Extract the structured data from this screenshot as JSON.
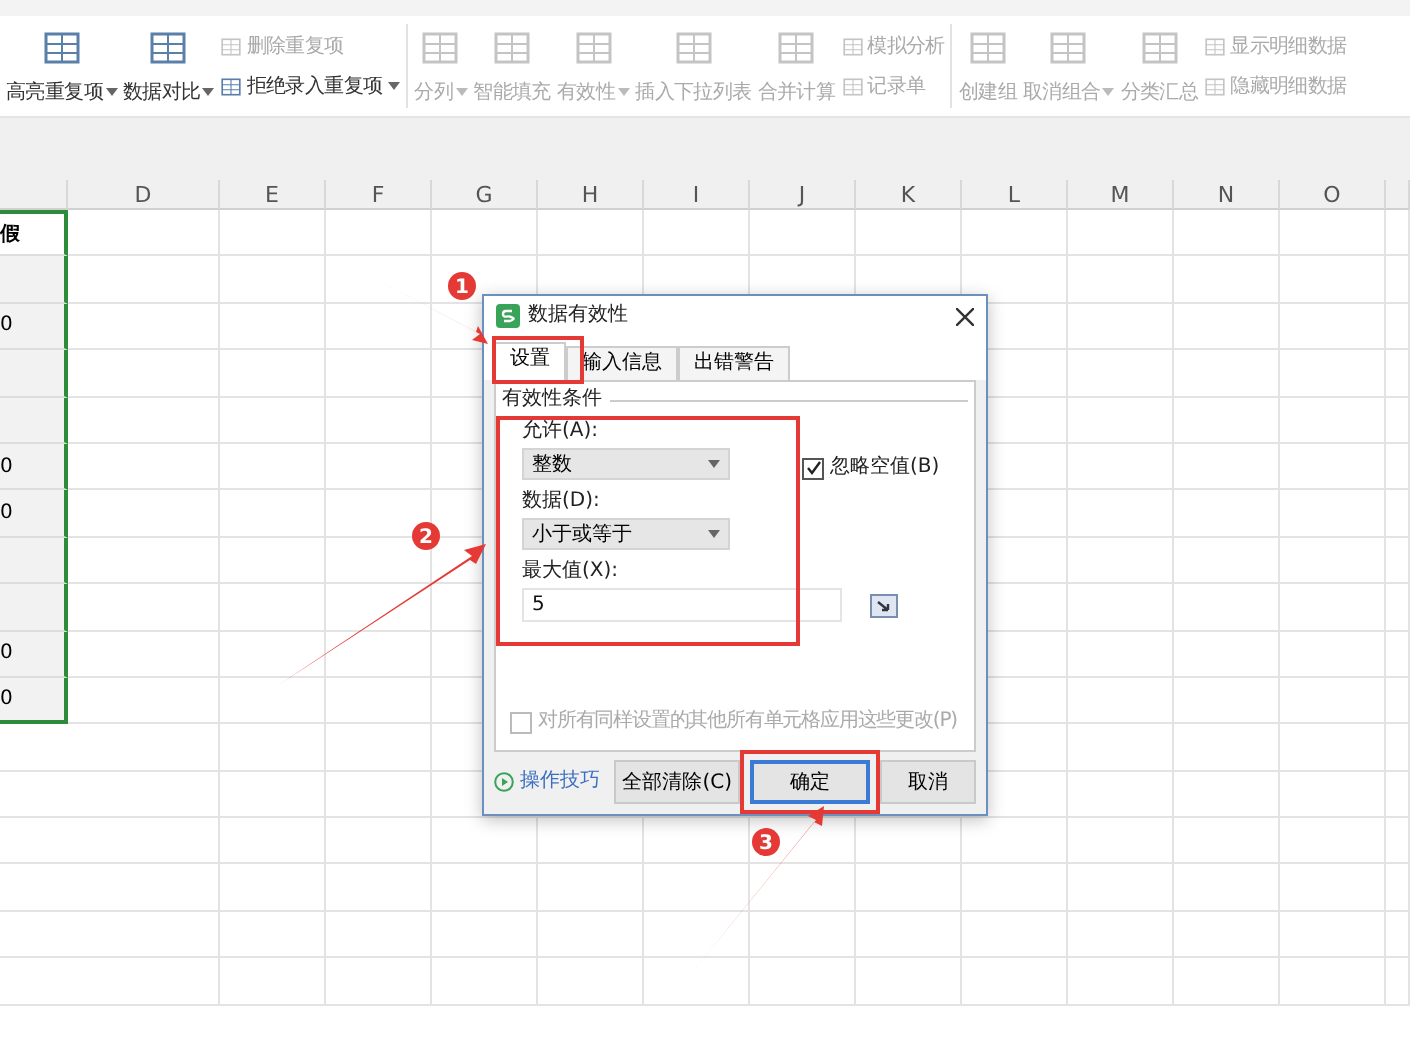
{
  "ribbon": {
    "items": [
      {
        "kind": "large",
        "label": "高亮重复项",
        "dropdown": true,
        "disabled": false
      },
      {
        "kind": "large",
        "label": "数据对比",
        "dropdown": true,
        "disabled": false
      },
      {
        "kind": "stack",
        "entries": [
          {
            "label": "删除重复项",
            "dropdown": false,
            "disabled": true
          },
          {
            "label": "拒绝录入重复项",
            "dropdown": true,
            "disabled": false
          }
        ]
      },
      {
        "kind": "separator"
      },
      {
        "kind": "large",
        "label": "分列",
        "dropdown": true,
        "disabled": true
      },
      {
        "kind": "large",
        "label": "智能填充",
        "dropdown": false,
        "disabled": true
      },
      {
        "kind": "large",
        "label": "有效性",
        "dropdown": true,
        "disabled": true
      },
      {
        "kind": "large",
        "label": "插入下拉列表",
        "dropdown": false,
        "disabled": true
      },
      {
        "kind": "large",
        "label": "合并计算",
        "dropdown": false,
        "disabled": true
      },
      {
        "kind": "stack",
        "entries": [
          {
            "label": "模拟分析",
            "dropdown": false,
            "disabled": true
          },
          {
            "label": "记录单",
            "dropdown": false,
            "disabled": true
          }
        ]
      },
      {
        "kind": "separator"
      },
      {
        "kind": "large",
        "label": "创建组",
        "dropdown": false,
        "disabled": true
      },
      {
        "kind": "large",
        "label": "取消组合",
        "dropdown": true,
        "disabled": true
      },
      {
        "kind": "large",
        "label": "分类汇总",
        "dropdown": false,
        "disabled": true
      },
      {
        "kind": "stack",
        "entries": [
          {
            "label": "显示明细数据",
            "dropdown": false,
            "disabled": true
          },
          {
            "label": "隐藏明细数据",
            "dropdown": false,
            "disabled": true
          }
        ]
      }
    ]
  },
  "sheet": {
    "columns": [
      "",
      "D",
      "E",
      "F",
      "G",
      "H",
      "I",
      "J",
      "K",
      "L",
      "M",
      "N",
      "O"
    ],
    "rows": [
      {
        "cell": "假",
        "selected": true
      },
      {
        "cell": "",
        "selected": true
      },
      {
        "cell": "0",
        "selected": true
      },
      {
        "cell": "",
        "selected": true
      },
      {
        "cell": "",
        "selected": true
      },
      {
        "cell": "0",
        "selected": true
      },
      {
        "cell": "0",
        "selected": true
      },
      {
        "cell": "",
        "selected": true
      },
      {
        "cell": "",
        "selected": true
      },
      {
        "cell": "0",
        "selected": true
      },
      {
        "cell": "0",
        "selected": true
      },
      {
        "cell": "",
        "selected": false
      },
      {
        "cell": "",
        "selected": false
      },
      {
        "cell": "",
        "selected": false
      },
      {
        "cell": "",
        "selected": false
      },
      {
        "cell": "",
        "selected": false
      },
      {
        "cell": "",
        "selected": false
      }
    ]
  },
  "dialog": {
    "title": "数据有效性",
    "tabs": [
      {
        "label": "设置",
        "selected": true
      },
      {
        "label": "输入信息",
        "selected": false
      },
      {
        "label": "出错警告",
        "selected": false
      }
    ],
    "group_label": "有效性条件",
    "allow": {
      "label": "允许(A):",
      "value": "整数"
    },
    "ignore_blank": {
      "label": "忽略空值(B)",
      "checked": true
    },
    "data": {
      "label": "数据(D):",
      "value": "小于或等于"
    },
    "maximum": {
      "label": "最大值(X):",
      "value": "5"
    },
    "apply_all": {
      "label": "对所有同样设置的其他所有单元格应用这些更改(P)",
      "checked": false,
      "disabled": true
    },
    "tips_link": "操作技巧",
    "buttons": [
      {
        "label": "全部清除(C)",
        "default": false
      },
      {
        "label": "确定",
        "default": true
      },
      {
        "label": "取消",
        "default": false
      }
    ]
  },
  "annotations": [
    {
      "number": "1"
    },
    {
      "number": "2"
    },
    {
      "number": "3"
    }
  ]
}
